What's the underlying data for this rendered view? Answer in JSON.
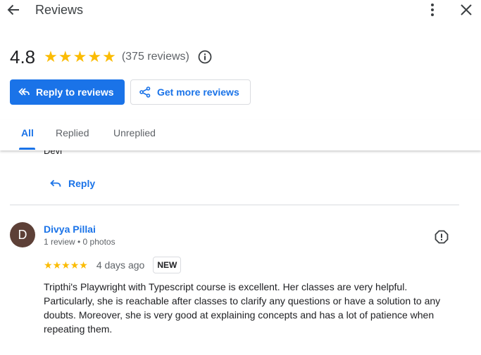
{
  "header": {
    "title": "Reviews",
    "icons": [
      "back-arrow-icon",
      "more-vert-icon",
      "close-icon"
    ]
  },
  "summary": {
    "rating": "4.8",
    "stars": 5,
    "review_count": "(375 reviews)",
    "star_color": "#fbbc04"
  },
  "actions": {
    "reply_to_reviews": "Reply to reviews",
    "get_more_reviews": "Get more reviews",
    "primary_color": "#1a73e8"
  },
  "tabs": [
    {
      "label": "All",
      "active": true
    },
    {
      "label": "Replied",
      "active": false
    },
    {
      "label": "Unreplied",
      "active": false
    }
  ],
  "previous_review": {
    "author_fragment": "Devi",
    "reply_label": "Reply"
  },
  "review": {
    "avatar_letter": "D",
    "avatar_color": "#5d4037",
    "name": "Divya Pillai",
    "meta": "1 review • 0 photos",
    "stars": 5,
    "date": "4 days ago",
    "badge": "NEW",
    "text": "Tripthi's Playwright with Typescript course is excellent. Her classes are very helpful. Particularly, she is reachable after classes to clarify any questions or have a solution to any doubts. Moreover, she is very good at explaining concepts and has a lot of patience when repeating them."
  }
}
